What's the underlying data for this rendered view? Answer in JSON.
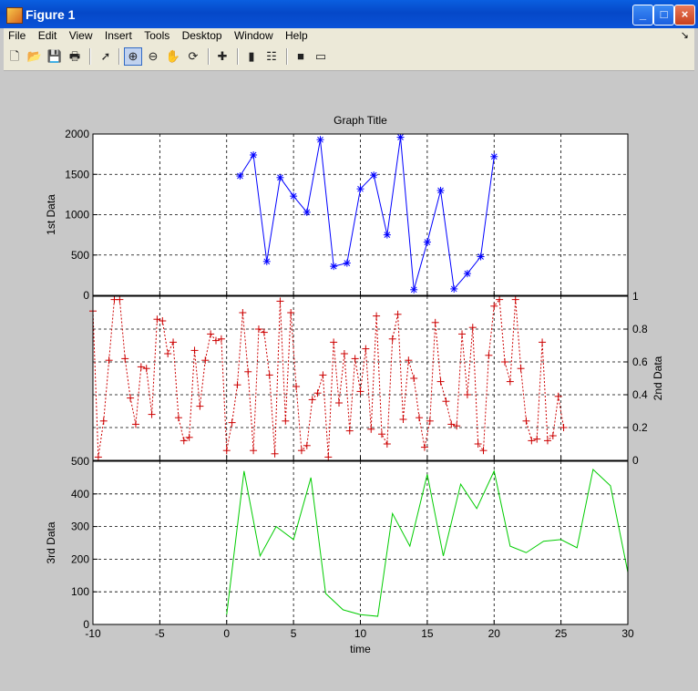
{
  "window": {
    "title": "Figure 1"
  },
  "menu": [
    "File",
    "Edit",
    "View",
    "Insert",
    "Tools",
    "Desktop",
    "Window",
    "Help"
  ],
  "toolbar_icons": [
    "new-file-icon",
    "open-folder-icon",
    "save-icon",
    "print-icon",
    "pointer-icon",
    "zoom-in-icon",
    "zoom-out-icon",
    "pan-icon",
    "rotate-icon",
    "data-cursor-icon",
    "colorbar-icon",
    "legend-icon",
    "hide-plot-tools-icon",
    "show-plot-tools-icon"
  ],
  "chart_data": [
    {
      "type": "line",
      "title": "Graph Title",
      "ylabel": "1st Data",
      "ylim": [
        0,
        2000
      ],
      "xlim": [
        -10,
        30
      ],
      "yticks": [
        0,
        500,
        1000,
        1500,
        2000
      ],
      "grid": true,
      "marker": "*",
      "color": "#0000ff",
      "x": [
        1,
        2,
        3,
        4,
        5,
        6,
        7,
        8,
        9,
        10,
        11,
        12,
        13,
        14,
        15,
        16,
        17,
        18,
        19,
        20
      ],
      "y": [
        1480,
        1740,
        420,
        1460,
        1230,
        1030,
        1930,
        360,
        400,
        1320,
        1490,
        750,
        1960,
        70,
        660,
        1300,
        80,
        270,
        480,
        1720
      ]
    },
    {
      "type": "line",
      "ylabel": "2nd Data",
      "ylim": [
        0,
        1
      ],
      "xlim": [
        -10,
        30
      ],
      "yticks": [
        0,
        0.2,
        0.4,
        0.6,
        0.8,
        1
      ],
      "grid": true,
      "marker": "+",
      "linestyle": "dotted",
      "color": "#cc0000",
      "x": [
        -10,
        -9.6,
        -9.2,
        -8.8,
        -8.4,
        -8,
        -7.6,
        -7.2,
        -6.8,
        -6.4,
        -6,
        -5.6,
        -5.2,
        -4.8,
        -4.4,
        -4,
        -3.6,
        -3.2,
        -2.8,
        -2.4,
        -2,
        -1.6,
        -1.2,
        -0.8,
        -0.4,
        0,
        0.4,
        0.8,
        1.2,
        1.6,
        2,
        2.4,
        2.8,
        3.2,
        3.6,
        4,
        4.4,
        4.8,
        5.2,
        5.6,
        6,
        6.4,
        6.8,
        7.2,
        7.6,
        8,
        8.4,
        8.8,
        9.2,
        9.6,
        10,
        10.4,
        10.8,
        11.2,
        11.6,
        12,
        12.4,
        12.8,
        13.2,
        13.6,
        14,
        14.4,
        14.8,
        15.2,
        15.6,
        16,
        16.4,
        16.8,
        17.2,
        17.6,
        18,
        18.4,
        18.8,
        19.2,
        19.6,
        20,
        20.4,
        20.8,
        21.2,
        21.6,
        22,
        22.4,
        22.8,
        23.2,
        23.6,
        24,
        24.4,
        24.8,
        25.2
      ],
      "y": [
        0.91,
        0.02,
        0.24,
        0.61,
        0.98,
        0.98,
        0.62,
        0.38,
        0.22,
        0.57,
        0.56,
        0.28,
        0.86,
        0.85,
        0.65,
        0.72,
        0.26,
        0.12,
        0.14,
        0.67,
        0.33,
        0.61,
        0.77,
        0.73,
        0.74,
        0.06,
        0.23,
        0.46,
        0.9,
        0.54,
        0.06,
        0.8,
        0.78,
        0.52,
        0.04,
        0.97,
        0.24,
        0.9,
        0.45,
        0.06,
        0.09,
        0.37,
        0.41,
        0.52,
        0.02,
        0.72,
        0.35,
        0.65,
        0.18,
        0.62,
        0.42,
        0.68,
        0.19,
        0.88,
        0.16,
        0.1,
        0.74,
        0.89,
        0.25,
        0.61,
        0.5,
        0.26,
        0.08,
        0.24,
        0.84,
        0.48,
        0.36,
        0.22,
        0.21,
        0.77,
        0.4,
        0.81,
        0.1,
        0.06,
        0.64,
        0.94,
        0.98,
        0.6,
        0.48,
        0.98,
        0.56,
        0.24,
        0.12,
        0.13,
        0.72,
        0.12,
        0.15,
        0.39,
        0.2
      ],
      "note_grid": "dashed black"
    },
    {
      "type": "line",
      "ylabel": "3rd Data",
      "xlabel": "time",
      "ylim": [
        0,
        500
      ],
      "xlim": [
        -10,
        30
      ],
      "yticks": [
        0,
        100,
        200,
        300,
        400,
        500
      ],
      "xticks": [
        -10,
        -5,
        0,
        5,
        10,
        15,
        20,
        25,
        30
      ],
      "grid": true,
      "color": "#00cc00",
      "x": [
        0,
        1.3,
        2.5,
        3.7,
        5,
        6.3,
        7.4,
        8.7,
        10,
        11.3,
        12.4,
        13.7,
        15,
        16.2,
        17.5,
        18.7,
        20,
        21.2,
        22.4,
        23.7,
        25,
        26.2,
        27.4,
        28.7,
        30
      ],
      "y": [
        30,
        470,
        210,
        300,
        260,
        450,
        95,
        45,
        30,
        25,
        340,
        240,
        460,
        210,
        430,
        355,
        470,
        240,
        220,
        255,
        260,
        235,
        475,
        425,
        160
      ]
    }
  ]
}
